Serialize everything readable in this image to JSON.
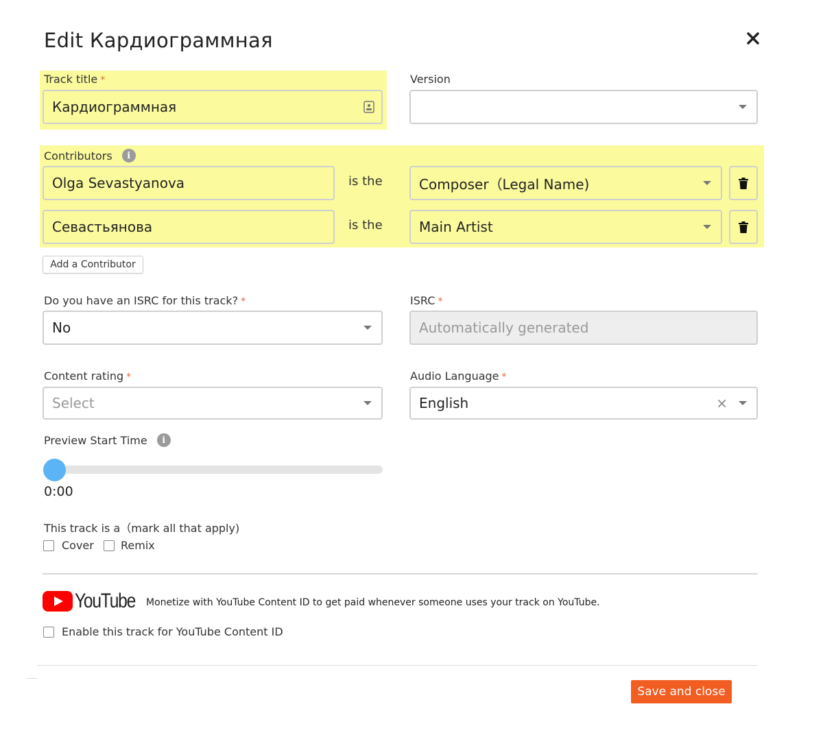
{
  "dialog": {
    "title": "Edit Кардиограммная",
    "close_label": "×"
  },
  "track_title": {
    "label": "Track title",
    "required": "*",
    "value": "Кардиограммная"
  },
  "version": {
    "label": "Version",
    "value": ""
  },
  "contributors": {
    "label": "Contributors",
    "rows": [
      {
        "name": "Olga Sevastyanova",
        "connector": "is the",
        "role": "Composer（Legal Name)"
      },
      {
        "name": "Севастьянова",
        "connector": "is the",
        "role": "Main Artist"
      }
    ],
    "add_label": "Add a Contributor"
  },
  "isrc_question": {
    "label": "Do you have an ISRC for this track?",
    "required": "*",
    "value": "No"
  },
  "isrc": {
    "label": "ISRC",
    "required": "*",
    "placeholder": "Automatically generated"
  },
  "content_rating": {
    "label": "Content rating",
    "required": "*",
    "placeholder": "Select"
  },
  "audio_language": {
    "label": "Audio Language",
    "required": "*",
    "value": "English",
    "clear": "×"
  },
  "preview": {
    "label": "Preview Start Time",
    "time": "0:00",
    "level": 0
  },
  "track_type": {
    "label": "This track is a（mark all that apply)",
    "options": [
      "Cover",
      "Remix"
    ]
  },
  "youtube": {
    "logo_text": "YouTube",
    "description": "Monetize with YouTube Content ID to get paid whenever someone uses your track on YouTube.",
    "checkbox_label": "Enable this track for YouTube Content ID"
  },
  "footer": {
    "save_label": "Save and close"
  },
  "colors": {
    "highlight": "#fbfb9e",
    "accent": "#f25d22",
    "slider": "#5bb4f5",
    "youtube_red": "#ff0000"
  }
}
